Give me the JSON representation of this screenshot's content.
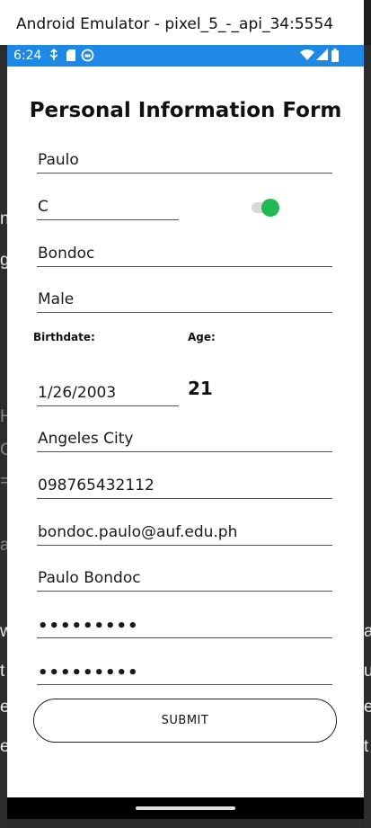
{
  "window": {
    "title": "Android Emulator - pixel_5_-_api_34:5554"
  },
  "status_bar": {
    "time": "6:24",
    "left_icons": [
      "usb-debug-icon",
      "sd-card-icon",
      "app-notification-icon"
    ],
    "right_icons": [
      "wifi-icon",
      "signal-icon",
      "battery-icon"
    ],
    "color": "#1e88e5"
  },
  "background_peek": {
    "left": [
      "n",
      "g",
      "H",
      "C",
      "=",
      "a",
      "w",
      "t",
      "e",
      "e"
    ],
    "right": [
      "a",
      "u",
      "e",
      "t"
    ]
  },
  "form": {
    "title": "Personal Information Form",
    "first_name": "Paulo",
    "middle_initial": "C",
    "toggle_on": true,
    "last_name": "Bondoc",
    "gender": "Male",
    "birthdate_label": "Birthdate:",
    "birthdate": "1/26/2003",
    "age_label": "Age:",
    "age": "21",
    "city": "Angeles City",
    "phone": "098765432112",
    "email": "bondoc.paulo@auf.edu.ph",
    "full_name": "Paulo Bondoc",
    "password": "•••••••••",
    "confirm_password": "•••••••••",
    "submit_label": "SUBMIT",
    "accent": "#1fba53"
  }
}
